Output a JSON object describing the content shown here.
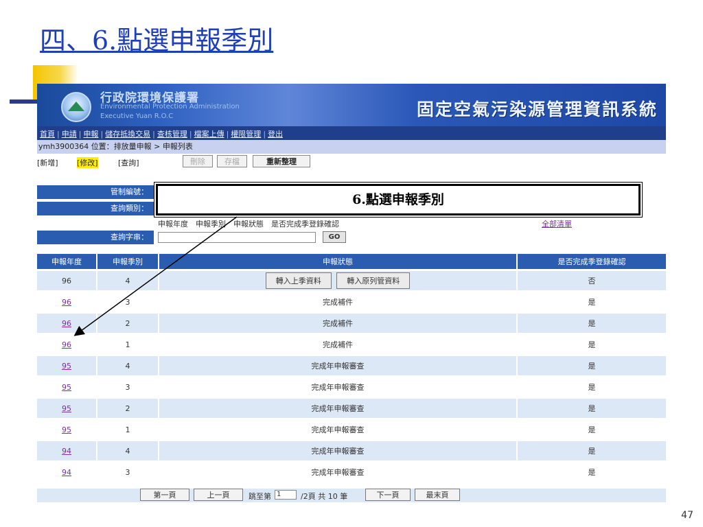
{
  "slide": {
    "title": "四、6.點選申報季別",
    "page_number": "47",
    "callout": "6.點選申報季別"
  },
  "header": {
    "org_cn": "行政院環境保護署",
    "org_en1": "Environmental Protection Administration",
    "org_en2": "Executive Yuan R.O.C",
    "system_name": "固定空氣污染源管理資訊系統"
  },
  "nav": {
    "items": [
      "首頁",
      "申請",
      "申報",
      "儲存抵換交易",
      "查核管理",
      "檔案上傳",
      "權限管理",
      "登出"
    ]
  },
  "location": {
    "user": "ymh3900364",
    "label": "位置：",
    "path": "排放量申報 > 申報列表"
  },
  "toolbar": {
    "add": "[新增]",
    "edit": "[修改]",
    "query": "[查詢]",
    "delete": "刪除",
    "save": "存檔",
    "reset": "重新整理"
  },
  "filters": {
    "control_no_label": "管制編號：",
    "query_type_label": "查詢類別：",
    "query_type_options": "申報年度　申報季別　申報狀態　是否完成季登錄確認",
    "query_type_all": "全部清單",
    "query_string_label": "查詢字串：",
    "query_string_value": "",
    "go_label": "GO"
  },
  "table": {
    "headers": [
      "申報年度",
      "申報季別",
      "申報狀態",
      "是否完成季登錄確認"
    ],
    "first_row": {
      "year": "96",
      "season": "4",
      "btn1": "轉入上季資料",
      "btn2": "轉入原列管資料",
      "confirm": "否"
    },
    "rows": [
      {
        "year": "96",
        "season": "3",
        "status": "完成補件",
        "confirm": "是"
      },
      {
        "year": "96",
        "season": "2",
        "status": "完成補件",
        "confirm": "是"
      },
      {
        "year": "96",
        "season": "1",
        "status": "完成補件",
        "confirm": "是"
      },
      {
        "year": "95",
        "season": "4",
        "status": "完成年申報審查",
        "confirm": "是"
      },
      {
        "year": "95",
        "season": "3",
        "status": "完成年申報審查",
        "confirm": "是"
      },
      {
        "year": "95",
        "season": "2",
        "status": "完成年申報審查",
        "confirm": "是"
      },
      {
        "year": "95",
        "season": "1",
        "status": "完成年申報審查",
        "confirm": "是"
      },
      {
        "year": "94",
        "season": "4",
        "status": "完成年申報審查",
        "confirm": "是"
      },
      {
        "year": "94",
        "season": "3",
        "status": "完成年申報審查",
        "confirm": "是"
      }
    ]
  },
  "pager": {
    "first": "第一頁",
    "prev": "上一頁",
    "jump_prefix": "跳至第",
    "jump_value": "1",
    "jump_suffix": "/2頁 共 10 筆",
    "next": "下一頁",
    "last": "最末頁"
  },
  "colors": {
    "title": "#1f3fb8",
    "header_blue": "#2a5db0",
    "row_alt": "#dce8f6",
    "highlight": "#ffee00"
  }
}
